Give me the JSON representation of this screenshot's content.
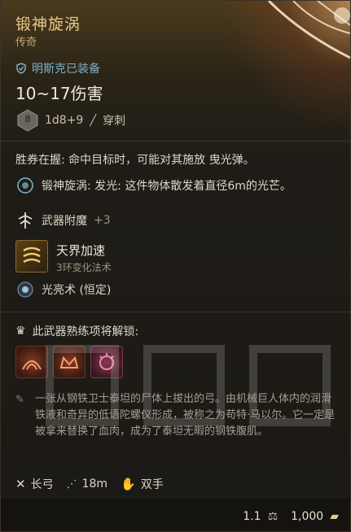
{
  "item": {
    "name": "锻神旋涡",
    "rarity": "传奇",
    "equipped_by": "明斯克已装备",
    "damage": "10~17伤害",
    "dice_value": "8",
    "dice_formula": "1d8+9",
    "damage_type": "穿刺"
  },
  "abilities": {
    "on_hit": "胜券在握: 命中目标时，可能对其施放 曳光弹。",
    "light_name": "锻神旋涡",
    "light_desc": ": 发光: 这件物体散发着直径6m的光芒。"
  },
  "enchant": {
    "label": "武器附魔",
    "bonus": "+3"
  },
  "spell": {
    "name": "天界加速",
    "level": "3环变化法术"
  },
  "cantrip": {
    "name": "光亮术 (恒定)"
  },
  "mastery": {
    "label": "此武器熟练项将解锁:",
    "icons": [
      "flourish-icon",
      "crown-strike-icon",
      "radiant-burst-icon"
    ]
  },
  "flavor": "一张从钢铁卫士泰坦的尸体上拔出的弓。由机械巨人体内的润滑铁液和奇异的低语陀螺仪形成，被称之为苟特·马以尔。它一定是被拿来替换了血肉，成为了泰坦无暇的钢铁腹肌。",
  "properties": {
    "type": "长弓",
    "range": "18m",
    "hands": "双手"
  },
  "footer": {
    "weight": "1.1",
    "price": "1,000"
  },
  "colors": {
    "title": "#e9c989",
    "equipped": "#7fb0c8",
    "text": "#ded6c6"
  }
}
